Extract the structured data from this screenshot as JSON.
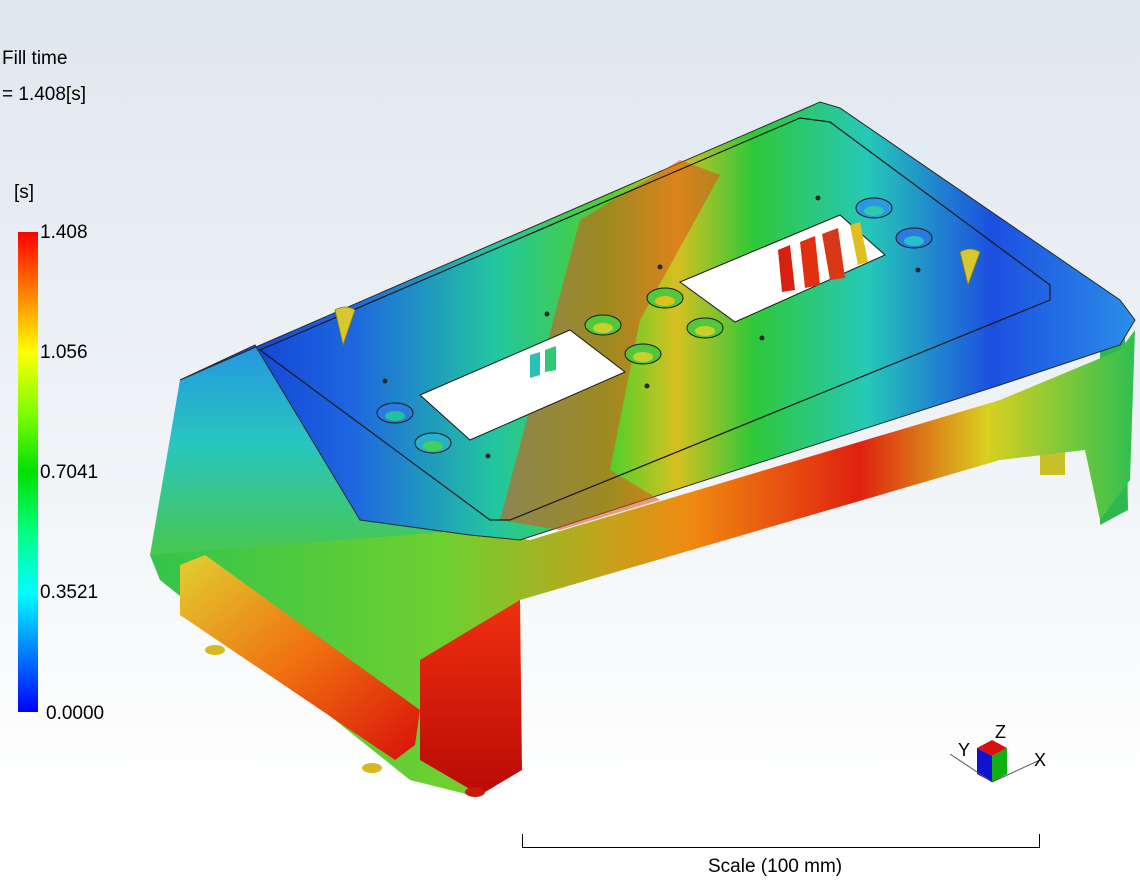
{
  "result": {
    "title": "Fill time",
    "value": " = 1.408[s]"
  },
  "legend": {
    "unit": "[s]",
    "ticks": [
      "1.408",
      "1.056",
      "0.7041",
      "0.3521",
      "0.0000"
    ],
    "max": 1.408,
    "min": 0.0
  },
  "scale": {
    "label": "Scale (100 mm)"
  },
  "triad": {
    "x_label": "X",
    "y_label": "Y",
    "z_label": "Z"
  },
  "colors": {
    "max": "#ff0000",
    "mid": "#00e000",
    "min": "#0000ff"
  }
}
